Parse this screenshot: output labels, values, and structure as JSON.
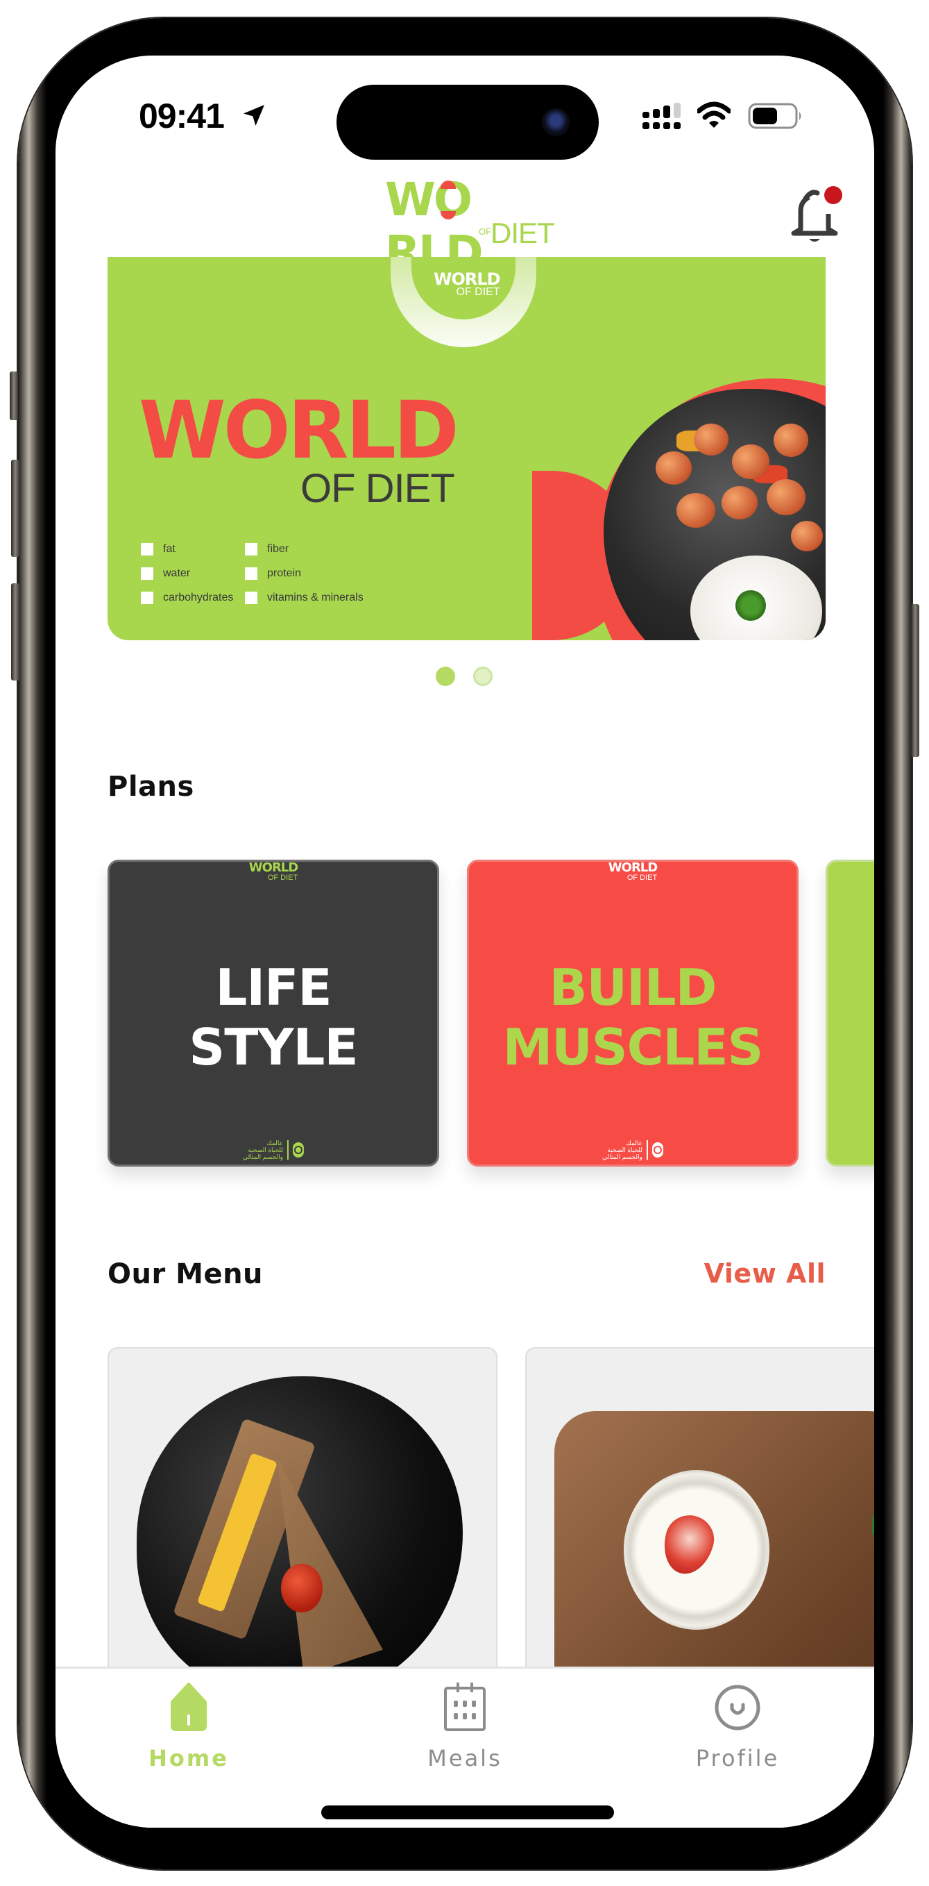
{
  "status_bar": {
    "time": "09:41",
    "location_icon": "location-arrow-icon",
    "signal_bars_active": 3,
    "signal_bars_total": 4,
    "wifi_icon": "wifi-icon",
    "battery_level": 0.6
  },
  "header": {
    "logo": {
      "world": "WORLD",
      "of": "OF",
      "diet": "DIET"
    },
    "notification_icon": "bell-icon",
    "has_unread_notification": true,
    "colors": {
      "brand_green": "#a8d64d",
      "brand_red": "#f24c45",
      "notification_dot": "#c8161d"
    }
  },
  "banner": {
    "mini_logo": {
      "world": "WORLD",
      "diet": "OF DIET"
    },
    "title": "WORLD",
    "subtitle": "OF DIET",
    "checklist": [
      "fat",
      "fiber",
      "water",
      "protein",
      "carbohydrates",
      "vitamins & minerals"
    ],
    "image": "shrimp-with-rice-plate",
    "pagination": {
      "total": 2,
      "active_index": 0
    }
  },
  "plans": {
    "title": "Plans",
    "cards": [
      {
        "line1": "LIFE",
        "line2": "STYLE",
        "mini_logo": "WORLD",
        "mini_logo_sub": "OF DIET",
        "footer_lines": [
          "عالمك",
          "للحياة الصحية",
          "والجسم المثالي"
        ],
        "background": "#3c3c3c",
        "text_color": "#ffffff"
      },
      {
        "line1": "BUILD",
        "line2": "MUSCLES",
        "mini_logo": "WORLD",
        "mini_logo_sub": "OF DIET",
        "footer_lines": [
          "عالمك",
          "للحياة الصحية",
          "والجسم المثالي"
        ],
        "background": "#f74c45",
        "text_color": "#acd74d"
      },
      {
        "background": "#acd74d"
      }
    ]
  },
  "menu": {
    "title": "Our Menu",
    "view_all_label": "View All",
    "items": [
      {
        "image": "cheese-toast-sandwich-with-cherry-tomato"
      },
      {
        "image": "milk-pudding-with-strawberry"
      }
    ]
  },
  "tab_bar": {
    "tabs": [
      {
        "label": "Home",
        "icon": "home-icon",
        "active": true
      },
      {
        "label": "Meals",
        "icon": "calendar-icon",
        "active": false
      },
      {
        "label": "Profile",
        "icon": "smiley-face-icon",
        "active": false
      }
    ],
    "active_color": "#b5da63",
    "inactive_color": "#8c8c8c"
  }
}
